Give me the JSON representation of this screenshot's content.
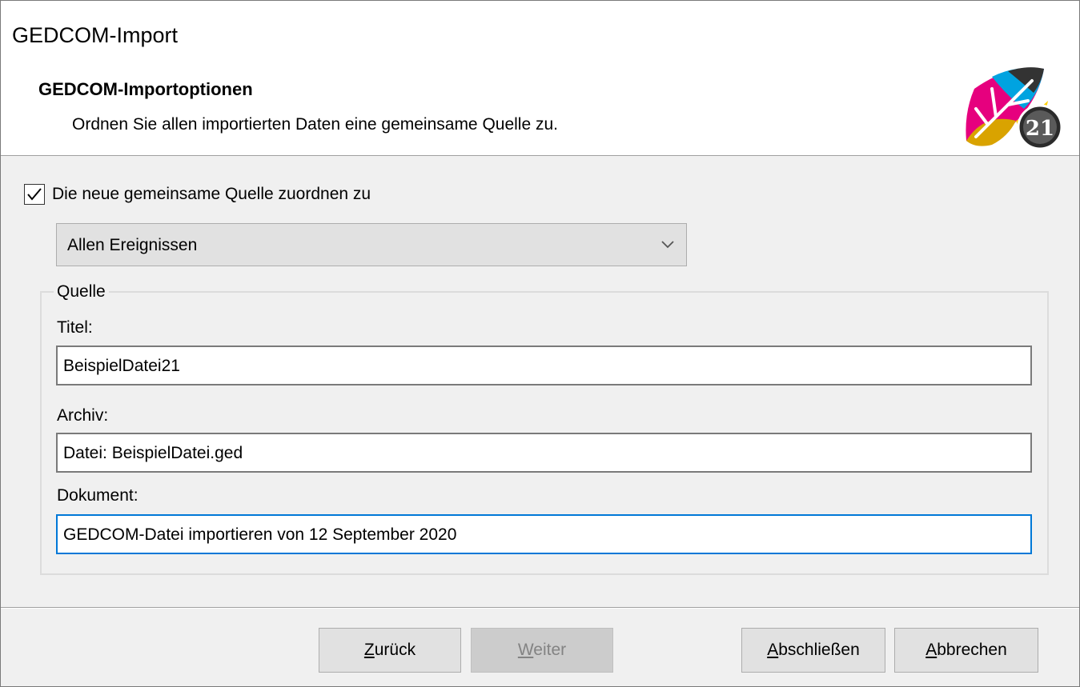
{
  "window": {
    "title": "GEDCOM-Import"
  },
  "header": {
    "heading": "GEDCOM-Importoptionen",
    "subtitle": "Ordnen Sie allen importierten Daten eine gemeinsame Quelle zu.",
    "logo_icon": "tree-21-logo-icon",
    "logo_badge": "21"
  },
  "assign_checkbox": {
    "label": "Die neue gemeinsame Quelle zuordnen zu",
    "checked": true
  },
  "target_dropdown": {
    "selected": "Allen Ereignissen",
    "arrow_icon": "chevron-down-icon"
  },
  "source_group": {
    "legend": "Quelle",
    "titel_label": "Titel:",
    "titel_value": "BeispielDatei21",
    "archiv_label": "Archiv:",
    "archiv_value": "Datei: BeispielDatei.ged",
    "dokument_label": "Dokument:",
    "dokument_value": "GEDCOM-Datei importieren von 12 September 2020"
  },
  "buttons": {
    "back": {
      "mnemonic": "Z",
      "rest": "urück",
      "enabled": true
    },
    "next": {
      "mnemonic": "W",
      "rest": "eiter",
      "enabled": false
    },
    "finish": {
      "mnemonic": "A",
      "rest": "bschließen",
      "enabled": true
    },
    "cancel": {
      "mnemonic": "A",
      "rest": "bbrechen",
      "enabled": true
    }
  },
  "colors": {
    "focus_border": "#0078d7",
    "dialog_bg": "#f0f0f0"
  }
}
